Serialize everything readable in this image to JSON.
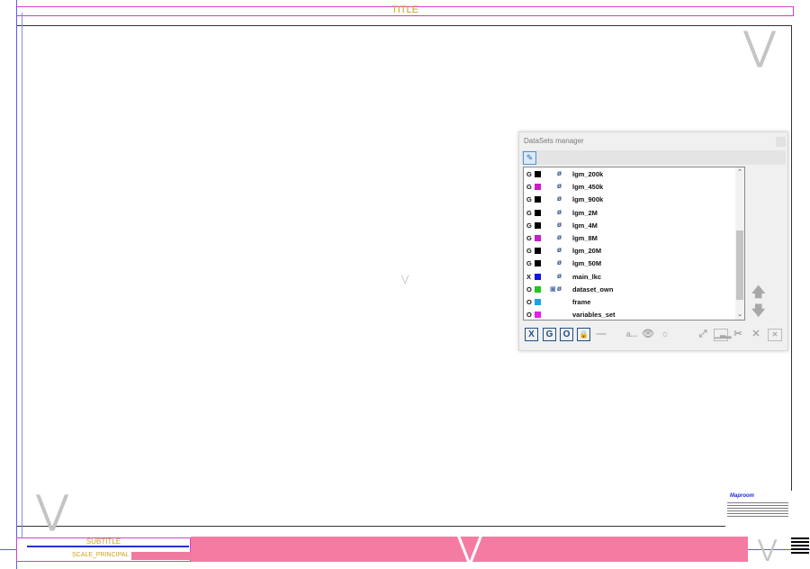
{
  "map": {
    "title": "TITLE",
    "subtitle": "SUBTITLE",
    "scale_label": "SCALE_PRINCIPAL",
    "info_box_title": "Maproom",
    "accent_colors": {
      "frame": "#d040d0",
      "text": "#c9a21a",
      "band": "#f47ba2",
      "guides": "#5a5af0"
    }
  },
  "panel": {
    "title": "DataSets manager",
    "pin_icon": "pin-icon",
    "rows": [
      {
        "type": "G",
        "color": "#000000",
        "name": "lgm_200k",
        "visible": false,
        "locked": false
      },
      {
        "type": "G",
        "color": "#c81ec8",
        "name": "lgm_450k",
        "visible": false,
        "locked": false
      },
      {
        "type": "G",
        "color": "#000000",
        "name": "lgm_900k",
        "visible": false,
        "locked": false
      },
      {
        "type": "G",
        "color": "#000000",
        "name": "lgm_2M",
        "visible": false,
        "locked": false
      },
      {
        "type": "G",
        "color": "#000000",
        "name": "lgm_4M",
        "visible": false,
        "locked": false
      },
      {
        "type": "G",
        "color": "#c81ec8",
        "name": "lgm_8M",
        "visible": false,
        "locked": false
      },
      {
        "type": "G",
        "color": "#000000",
        "name": "lgm_20M",
        "visible": false,
        "locked": false
      },
      {
        "type": "G",
        "color": "#000000",
        "name": "lgm_50M",
        "visible": false,
        "locked": false
      },
      {
        "type": "X",
        "color": "#1414e6",
        "name": "main_lkc",
        "visible": false,
        "locked": false
      },
      {
        "type": "O",
        "color": "#1ec81e",
        "name": "dataset_own",
        "visible": false,
        "locked": true
      },
      {
        "type": "O",
        "color": "#1ea0e6",
        "name": "frame",
        "visible": true,
        "locked": false
      },
      {
        "type": "O",
        "color": "#e61ee6",
        "name": "variables_set",
        "visible": true,
        "locked": false
      }
    ],
    "bottom_buttons": {
      "x": "X",
      "g": "G",
      "o": "O",
      "lock": "🔒",
      "minus": "—",
      "label": "a...",
      "eye": "👁",
      "sun": "☼"
    },
    "move_up": "🡅",
    "move_down": "🡇"
  }
}
